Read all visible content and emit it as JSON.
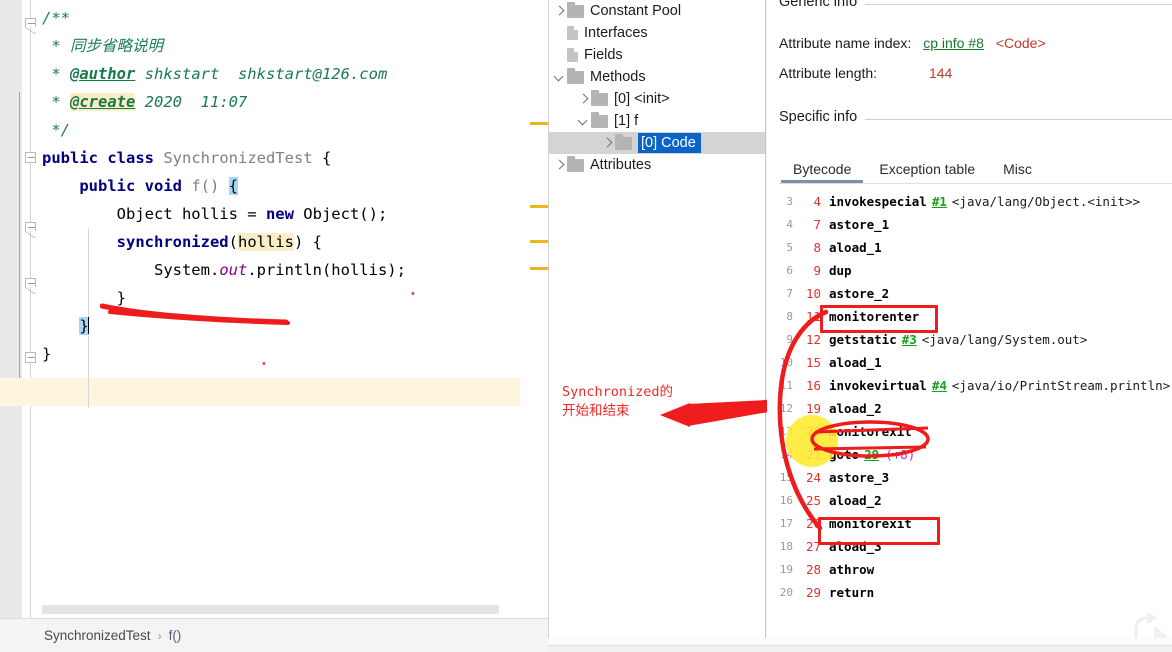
{
  "editor": {
    "code_lines": [
      {
        "id": "l1",
        "segments": [
          {
            "t": "/**",
            "c": "jd"
          }
        ]
      },
      {
        "id": "l2",
        "segments": [
          {
            "t": " * ",
            "c": "jd"
          },
          {
            "t": "同步省略说明",
            "c": "jd"
          }
        ]
      },
      {
        "id": "l3",
        "segments": [
          {
            "t": " * ",
            "c": "jd"
          },
          {
            "t": "@author",
            "c": "jd-tag"
          },
          {
            "t": " shkstart  shkstart@126.com",
            "c": "jd"
          }
        ]
      },
      {
        "id": "l4",
        "segments": [
          {
            "t": " * ",
            "c": "jd"
          },
          {
            "t": "@create",
            "c": "jd-tag hl-tan"
          },
          {
            "t": " 2020  11:07",
            "c": "jd"
          }
        ]
      },
      {
        "id": "l5",
        "segments": [
          {
            "t": " */",
            "c": "jd"
          }
        ]
      },
      {
        "id": "l6",
        "segments": [
          {
            "t": "public class ",
            "c": "kw"
          },
          {
            "t": "SynchronizedTest",
            "c": "cls"
          },
          {
            "t": " {",
            "c": "plain"
          }
        ]
      },
      {
        "id": "l7",
        "segments": [
          {
            "t": "    public void ",
            "c": "kw"
          },
          {
            "t": "f()",
            "c": "cls"
          },
          {
            "t": " ",
            "c": "plain"
          },
          {
            "t": "{",
            "c": "plain brace-hl"
          }
        ]
      },
      {
        "id": "l8",
        "segments": [
          {
            "t": "        Object hollis = ",
            "c": "plain"
          },
          {
            "t": "new",
            "c": "kw"
          },
          {
            "t": " Object();",
            "c": "plain"
          }
        ]
      },
      {
        "id": "l9",
        "segments": [
          {
            "t": "        ",
            "c": "plain"
          },
          {
            "t": "synchronized",
            "c": "kw"
          },
          {
            "t": "(",
            "c": "plain"
          },
          {
            "t": "hollis",
            "c": "plain var-hl"
          },
          {
            "t": ") {",
            "c": "plain"
          }
        ]
      },
      {
        "id": "l10",
        "segments": [
          {
            "t": "            System.",
            "c": "plain"
          },
          {
            "t": "out",
            "c": "field-static"
          },
          {
            "t": ".println(hollis);",
            "c": "plain"
          }
        ]
      },
      {
        "id": "l11",
        "segments": [
          {
            "t": "        }",
            "c": "plain"
          }
        ]
      },
      {
        "id": "l12",
        "segments": [
          {
            "t": "    ",
            "c": "plain"
          },
          {
            "t": "}",
            "c": "plain brace-hl"
          }
        ]
      },
      {
        "id": "l13",
        "segments": [
          {
            "t": "}",
            "c": "plain"
          }
        ]
      }
    ],
    "breadcrumb": {
      "class": "SynchronizedTest",
      "separator": "›",
      "method": "f()"
    },
    "scrollbar_warning_markers": [
      122,
      205,
      240,
      267
    ]
  },
  "tree": {
    "items": [
      {
        "label": "Constant Pool",
        "icon": "folder-icon",
        "chevron": "right",
        "indent": 0,
        "selected": false
      },
      {
        "label": "Interfaces",
        "icon": "file-icon",
        "chevron": "none",
        "indent": 0,
        "selected": false
      },
      {
        "label": "Fields",
        "icon": "file-icon",
        "chevron": "none",
        "indent": 0,
        "selected": false
      },
      {
        "label": "Methods",
        "icon": "folder-icon",
        "chevron": "down",
        "indent": 0,
        "selected": false
      },
      {
        "label": "[0] <init>",
        "icon": "folder-icon",
        "chevron": "right",
        "indent": 1,
        "selected": false
      },
      {
        "label": "[1] f",
        "icon": "folder-icon",
        "chevron": "down",
        "indent": 1,
        "selected": false
      },
      {
        "label": "[0] Code",
        "icon": "folder-icon",
        "chevron": "right",
        "indent": 2,
        "selected": true
      },
      {
        "label": "Attributes",
        "icon": "folder-icon",
        "chevron": "right",
        "indent": 0,
        "selected": false
      }
    ]
  },
  "annotation": {
    "line1": "Synchronized的",
    "line2": "开始和结束",
    "color": "#f02828"
  },
  "detail": {
    "generic_info_title": "Generic info",
    "specific_info_title": "Specific info",
    "rows": [
      {
        "label": "Attribute name index:",
        "value": "cp info #8",
        "value_kind": "link",
        "suffix": "<Code>"
      },
      {
        "label": "Attribute length:",
        "value": "144",
        "value_kind": "number",
        "suffix": ""
      }
    ],
    "tabs": [
      {
        "label": "Bytecode",
        "active": true
      },
      {
        "label": "Exception table",
        "active": false
      },
      {
        "label": "Misc",
        "active": false
      }
    ]
  },
  "bytecode": {
    "rows": [
      {
        "line": "3",
        "offset": "4",
        "mnemonic": "invokespecial",
        "ref": "#1",
        "desc": "<java/lang/Object.<init>>",
        "delta": ""
      },
      {
        "line": "4",
        "offset": "7",
        "mnemonic": "astore_1",
        "ref": "",
        "desc": "",
        "delta": ""
      },
      {
        "line": "5",
        "offset": "8",
        "mnemonic": "aload_1",
        "ref": "",
        "desc": "",
        "delta": ""
      },
      {
        "line": "6",
        "offset": "9",
        "mnemonic": "dup",
        "ref": "",
        "desc": "",
        "delta": ""
      },
      {
        "line": "7",
        "offset": "10",
        "mnemonic": "astore_2",
        "ref": "",
        "desc": "",
        "delta": ""
      },
      {
        "line": "8",
        "offset": "11",
        "mnemonic": "monitorenter",
        "ref": "",
        "desc": "",
        "delta": ""
      },
      {
        "line": "9",
        "offset": "12",
        "mnemonic": "getstatic",
        "ref": "#3",
        "desc": "<java/lang/System.out>",
        "delta": ""
      },
      {
        "line": "10",
        "offset": "15",
        "mnemonic": "aload_1",
        "ref": "",
        "desc": "",
        "delta": ""
      },
      {
        "line": "11",
        "offset": "16",
        "mnemonic": "invokevirtual",
        "ref": "#4",
        "desc": "<java/io/PrintStream.println>",
        "delta": ""
      },
      {
        "line": "12",
        "offset": "19",
        "mnemonic": "aload_2",
        "ref": "",
        "desc": "",
        "delta": ""
      },
      {
        "line": "13",
        "offset": "20",
        "mnemonic": "monitorexit",
        "ref": "",
        "desc": "",
        "delta": ""
      },
      {
        "line": "14",
        "offset": "21",
        "mnemonic": "goto",
        "ref": "29",
        "desc": "",
        "delta": "(+8)"
      },
      {
        "line": "15",
        "offset": "24",
        "mnemonic": "astore_3",
        "ref": "",
        "desc": "",
        "delta": ""
      },
      {
        "line": "16",
        "offset": "25",
        "mnemonic": "aload_2",
        "ref": "",
        "desc": "",
        "delta": ""
      },
      {
        "line": "17",
        "offset": "26",
        "mnemonic": "monitorexit",
        "ref": "",
        "desc": "",
        "delta": ""
      },
      {
        "line": "18",
        "offset": "27",
        "mnemonic": "aload_3",
        "ref": "",
        "desc": "",
        "delta": ""
      },
      {
        "line": "19",
        "offset": "28",
        "mnemonic": "athrow",
        "ref": "",
        "desc": "",
        "delta": ""
      },
      {
        "line": "20",
        "offset": "29",
        "mnemonic": "return",
        "ref": "",
        "desc": "",
        "delta": ""
      }
    ],
    "highlight_rows": [
      5,
      10,
      16
    ]
  },
  "colors": {
    "annotation_red": "#ee1c1c",
    "highlight_yellow": "#ffe92e",
    "selection_blue": "#0a64c8",
    "keyword_blue": "#000080",
    "javadoc_green": "#1a7c52",
    "offset_red": "#e0342b",
    "ref_green": "#18a01c"
  }
}
